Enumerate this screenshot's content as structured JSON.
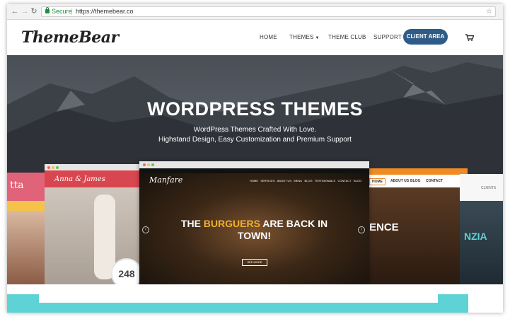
{
  "browser": {
    "secure_label": "Secure",
    "url": "https://themebear.co",
    "back_icon": "arrow-left-icon",
    "forward_icon": "arrow-right-icon",
    "reload_icon": "reload-icon",
    "bookmark_icon": "star-icon"
  },
  "site": {
    "logo": "ThemeBear",
    "nav": [
      {
        "label": "HOME"
      },
      {
        "label": "THEMES"
      },
      {
        "label": "THEME CLUB"
      },
      {
        "label": "SUPPORT"
      }
    ],
    "cta": "CLIENT AREA",
    "accent": "#2f5c87",
    "cart_icon": "cart-icon"
  },
  "hero": {
    "title": "WORDPRESS THEMES",
    "subtitle_line1": "WordPress Themes Crafted With Love.",
    "subtitle_line2": "Highstand Design, Easy Customization and Premium Support"
  },
  "mockups": {
    "far_left": {
      "brand": "tta"
    },
    "left": {
      "brand": "Anna & James",
      "counter": "248"
    },
    "center": {
      "brand": "Manfare",
      "nav": [
        "HOME",
        "SERVICES",
        "ABOUT US",
        "MENU",
        "BLOG",
        "TESTIMONIALS",
        "CONTACT",
        "BLOG"
      ],
      "headline_pre": "THE ",
      "headline_accent": "BURGUERS",
      "headline_post": " ARE BACK IN",
      "headline_line2": "TOWN!",
      "button": "SEE MORE"
    },
    "right": {
      "nav": [
        "HOME",
        "ABOUT US",
        "BLOG",
        "CONTACT"
      ],
      "headline": "ENCE"
    },
    "far_right": {
      "nav": "CLIENTS",
      "headline": "NZIA"
    }
  }
}
